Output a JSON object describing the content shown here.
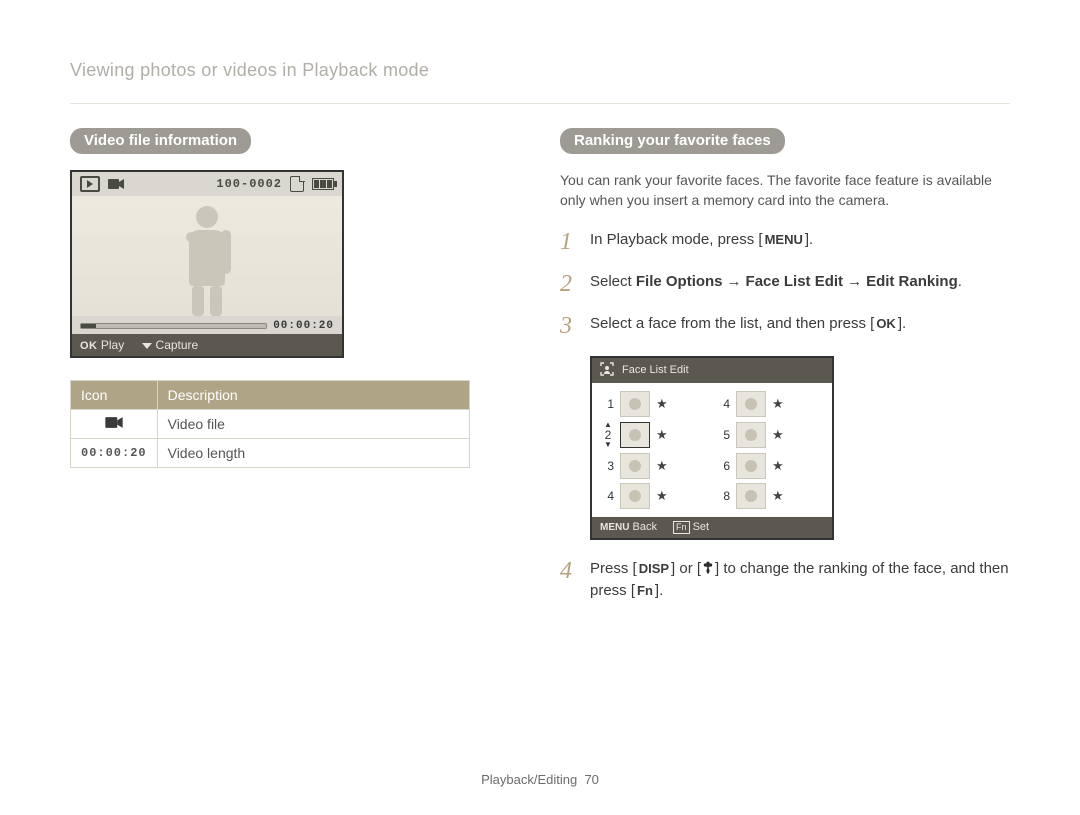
{
  "breadcrumb": "Viewing photos or videos in Playback mode",
  "left": {
    "pill": "Video file information",
    "lcd": {
      "file_no": "100-0002",
      "elapsed": "00:00:20",
      "ok_label": "Play",
      "capture_label": "Capture"
    },
    "table": {
      "headers": {
        "icon": "Icon",
        "desc": "Description"
      },
      "rows": [
        {
          "icon_name": "movie-icon",
          "desc": "Video file"
        },
        {
          "icon_text": "00:00:20",
          "desc": "Video length"
        }
      ]
    }
  },
  "right": {
    "pill": "Ranking your favorite faces",
    "intro": "You can rank your favorite faces. The favorite face feature is available only when you insert a memory card into the camera.",
    "steps": {
      "s1_a": "In Playback mode, press [",
      "s1_btn": "MENU",
      "s1_b": "].",
      "s2_a": "Select ",
      "s2_b1": "File Options",
      "s2_arrow": "→",
      "s2_b2": "Face List Edit",
      "s2_b3": "Edit Ranking",
      "s2_end": ".",
      "s3_a": "Select a face from the list, and then press [",
      "s3_btn": "OK",
      "s3_b": "].",
      "s4_a": "Press [",
      "s4_btn1": "DISP",
      "s4_mid": "] or [",
      "s4_btn2_name": "macro-flower-icon",
      "s4_b": "] to change the ranking of the face, and then press [",
      "s4_btn3": "Fn",
      "s4_c": "]."
    },
    "faceLcd": {
      "title": "Face List Edit",
      "rows_left": [
        "1",
        "2",
        "3",
        "4"
      ],
      "rows_right": [
        "4",
        "5",
        "6",
        "8"
      ],
      "back_label": "Back",
      "set_label": "Set",
      "menu_label": "MENU",
      "fn_label": "Fn"
    }
  },
  "footer": {
    "section": "Playback/Editing",
    "page": "70"
  }
}
